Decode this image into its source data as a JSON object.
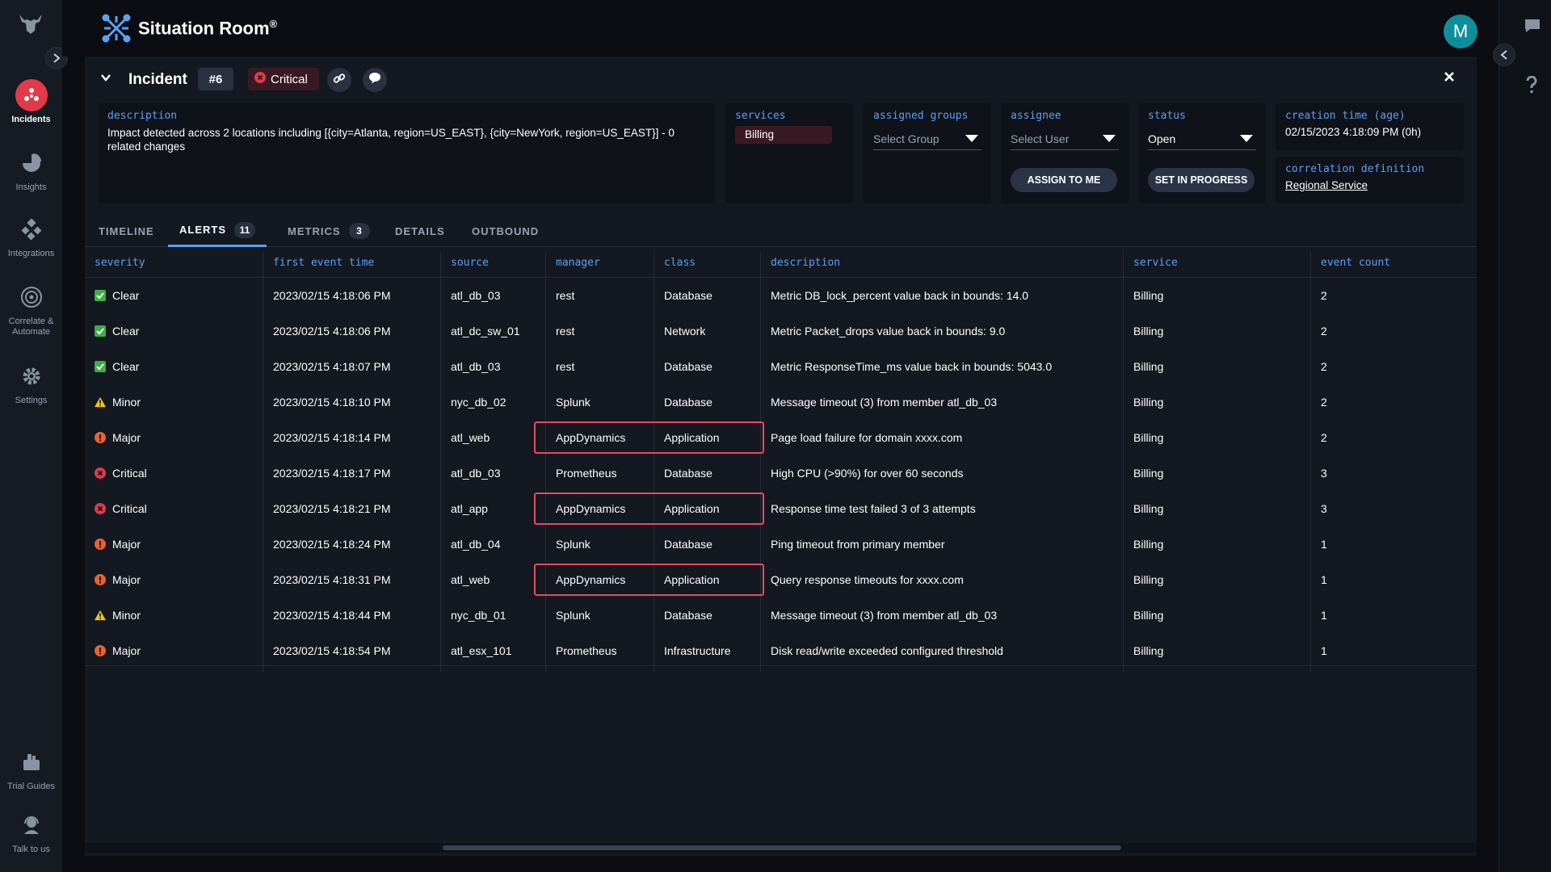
{
  "nav": {
    "items": [
      {
        "label": "Incidents"
      },
      {
        "label": "Insights"
      },
      {
        "label": "Integrations"
      },
      {
        "label": "Correlate & Automate"
      },
      {
        "label": "Settings"
      },
      {
        "label": "Trial Guides"
      },
      {
        "label": "Talk to us"
      }
    ]
  },
  "header": {
    "title": "Situation Room",
    "trademark": "®",
    "avatar_initial": "M"
  },
  "incident": {
    "title": "Incident",
    "number": "#6",
    "severity": "Critical",
    "description_label": "description",
    "description": "Impact detected across 2 locations including [{city=Atlanta, region=US_EAST}, {city=NewYork, region=US_EAST}] - 0 related changes",
    "services_label": "services",
    "service": "Billing",
    "groups_label": "assigned groups",
    "groups_placeholder": "Select Group",
    "assignee_label": "assignee",
    "assignee_placeholder": "Select User",
    "assign_button": "ASSIGN TO ME",
    "status_label": "status",
    "status_value": "Open",
    "progress_button": "SET IN PROGRESS",
    "creation_label": "creation time (age)",
    "creation_value": "02/15/2023 4:18:09 PM (0h)",
    "correlation_label": "correlation definition",
    "correlation_value": "Regional Service"
  },
  "tabs": [
    {
      "label": "TIMELINE",
      "count": ""
    },
    {
      "label": "ALERTS",
      "count": "11"
    },
    {
      "label": "METRICS",
      "count": "3"
    },
    {
      "label": "DETAILS",
      "count": ""
    },
    {
      "label": "OUTBOUND",
      "count": ""
    }
  ],
  "table": {
    "columns": [
      "severity",
      "first event time",
      "source",
      "manager",
      "class",
      "description",
      "service",
      "event count"
    ],
    "rows": [
      {
        "severity": "Clear",
        "time": "2023/02/15 4:18:06 PM",
        "source": "atl_db_03",
        "manager": "rest",
        "class": "Database",
        "description": "Metric DB_lock_percent value back in bounds: 14.0",
        "service": "Billing",
        "count": "2"
      },
      {
        "severity": "Clear",
        "time": "2023/02/15 4:18:06 PM",
        "source": "atl_dc_sw_01",
        "manager": "rest",
        "class": "Network",
        "description": "Metric Packet_drops value back in bounds: 9.0",
        "service": "Billing",
        "count": "2"
      },
      {
        "severity": "Clear",
        "time": "2023/02/15 4:18:07 PM",
        "source": "atl_db_03",
        "manager": "rest",
        "class": "Database",
        "description": "Metric ResponseTime_ms value back in bounds: 5043.0",
        "service": "Billing",
        "count": "2"
      },
      {
        "severity": "Minor",
        "time": "2023/02/15 4:18:10 PM",
        "source": "nyc_db_02",
        "manager": "Splunk",
        "class": "Database",
        "description": "Message timeout (3) from member atl_db_03",
        "service": "Billing",
        "count": "2"
      },
      {
        "severity": "Major",
        "time": "2023/02/15 4:18:14 PM",
        "source": "atl_web",
        "manager": "AppDynamics",
        "class": "Application",
        "description": "Page load failure for domain xxxx.com",
        "service": "Billing",
        "count": "2"
      },
      {
        "severity": "Critical",
        "time": "2023/02/15 4:18:17 PM",
        "source": "atl_db_03",
        "manager": "Prometheus",
        "class": "Database",
        "description": "High CPU (>90%) for over 60 seconds",
        "service": "Billing",
        "count": "3"
      },
      {
        "severity": "Critical",
        "time": "2023/02/15 4:18:21 PM",
        "source": "atl_app",
        "manager": "AppDynamics",
        "class": "Application",
        "description": "Response time test failed 3 of 3 attempts",
        "service": "Billing",
        "count": "3"
      },
      {
        "severity": "Major",
        "time": "2023/02/15 4:18:24 PM",
        "source": "atl_db_04",
        "manager": "Splunk",
        "class": "Database",
        "description": "Ping timeout from primary member",
        "service": "Billing",
        "count": "1"
      },
      {
        "severity": "Major",
        "time": "2023/02/15 4:18:31 PM",
        "source": "atl_web",
        "manager": "AppDynamics",
        "class": "Application",
        "description": "Query response timeouts for xxxx.com",
        "service": "Billing",
        "count": "1"
      },
      {
        "severity": "Minor",
        "time": "2023/02/15 4:18:44 PM",
        "source": "nyc_db_01",
        "manager": "Splunk",
        "class": "Database",
        "description": "Message timeout (3) from member atl_db_03",
        "service": "Billing",
        "count": "1"
      },
      {
        "severity": "Major",
        "time": "2023/02/15 4:18:54 PM",
        "source": "atl_esx_101",
        "manager": "Prometheus",
        "class": "Infrastructure",
        "description": "Disk read/write exceeded configured threshold",
        "service": "Billing",
        "count": "1"
      }
    ],
    "highlighted_manager": "AppDynamics"
  },
  "colors": {
    "accent": "#5aa1f5",
    "critical": "#e23a4b",
    "major": "#f0602a",
    "minor": "#f5c518",
    "clear": "#3cb043",
    "highlight": "#e84a5f"
  }
}
